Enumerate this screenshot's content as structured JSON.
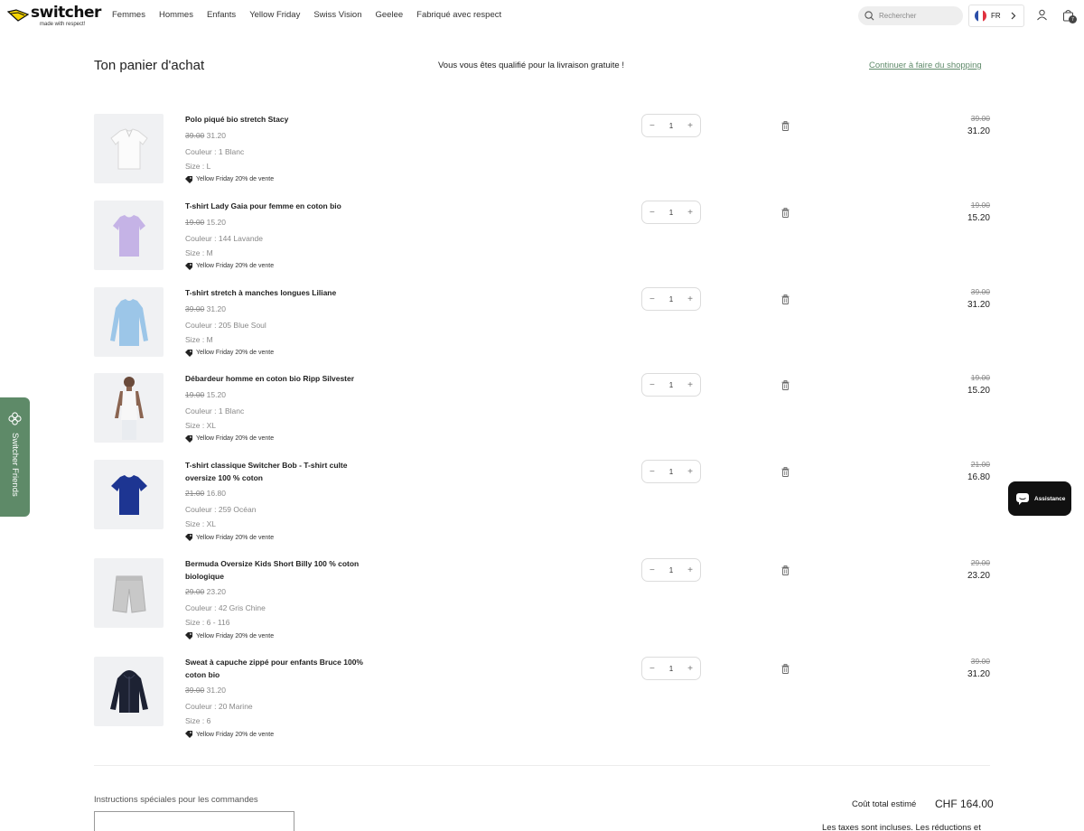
{
  "header": {
    "logo": {
      "word": "switcher",
      "tagline": "made with respect!"
    },
    "nav": [
      "Femmes",
      "Hommes",
      "Enfants",
      "Yellow Friday",
      "Swiss Vision",
      "Geelee",
      "Fabriqué avec respect"
    ],
    "search_placeholder": "Rechercher",
    "language": "FR",
    "cart_count": "7"
  },
  "page": {
    "title": "Ton panier d'achat",
    "free_shipping": "Vous vous êtes qualifié pour la livraison gratuite !",
    "continue_link": "Continuer à faire du shopping"
  },
  "items": [
    {
      "name": "Polo piqué bio stretch Stacy",
      "old_price": "39.00",
      "price": "31.20",
      "color": "Couleur : 1 Blanc",
      "size": "Size : L",
      "promo": "Yellow Friday 20% de vente",
      "qty": "1",
      "line_old": "39.00",
      "line_total": "31.20",
      "image": "white-polo"
    },
    {
      "name": "T-shirt Lady Gaia pour femme en coton bio",
      "old_price": "19.00",
      "price": "15.20",
      "color": "Couleur : 144 Lavande",
      "size": "Size : M",
      "promo": "Yellow Friday 20% de vente",
      "qty": "1",
      "line_old": "19.00",
      "line_total": "15.20",
      "image": "lavender-tshirt"
    },
    {
      "name": "T-shirt stretch à manches longues Liliane",
      "old_price": "39.00",
      "price": "31.20",
      "color": "Couleur : 205 Blue Soul",
      "size": "Size : M",
      "promo": "Yellow Friday 20% de vente",
      "qty": "1",
      "line_old": "39.00",
      "line_total": "31.20",
      "image": "blue-longsleeve"
    },
    {
      "name": "Débardeur homme en coton bio Ripp Silvester",
      "old_price": "19.00",
      "price": "15.20",
      "color": "Couleur : 1 Blanc",
      "size": "Size : XL",
      "promo": "Yellow Friday 20% de vente",
      "qty": "1",
      "line_old": "19.00",
      "line_total": "15.20",
      "image": "tank-top-model"
    },
    {
      "name": "T-shirt classique Switcher Bob - T-shirt culte oversize 100 % coton",
      "old_price": "21.00",
      "price": "16.80",
      "color": "Couleur : 259 Océan",
      "size": "Size : XL",
      "promo": "Yellow Friday 20% de vente",
      "qty": "1",
      "line_old": "21.00",
      "line_total": "16.80",
      "image": "ocean-tshirt"
    },
    {
      "name": "Bermuda Oversize Kids Short Billy 100 % coton biologique",
      "old_price": "29.00",
      "price": "23.20",
      "color": "Couleur : 42 Gris Chine",
      "size": "Size : 6 - 116",
      "promo": "Yellow Friday 20% de vente",
      "qty": "1",
      "line_old": "29.00",
      "line_total": "23.20",
      "image": "grey-shorts"
    },
    {
      "name": "Sweat à capuche zippé pour enfants Bruce 100% coton bio",
      "old_price": "39.00",
      "price": "31.20",
      "color": "Couleur : 20 Marine",
      "size": "Size : 6",
      "promo": "Yellow Friday 20% de vente",
      "qty": "1",
      "line_old": "39.00",
      "line_total": "31.20",
      "image": "navy-hoodie"
    }
  ],
  "footer": {
    "instructions_label": "Instructions spéciales pour les commandes",
    "estimated_label": "Coût total estimé",
    "estimated_value": "CHF 164.00",
    "tax_note": "Les taxes sont incluses. Les réductions et"
  },
  "widgets": {
    "friends_label": "Switcher Friends",
    "chat_label": "Assistance"
  },
  "colors": {
    "accent": "#5e8a68",
    "link": "#5f8a6a",
    "logo_yellow": "#f5d400"
  }
}
